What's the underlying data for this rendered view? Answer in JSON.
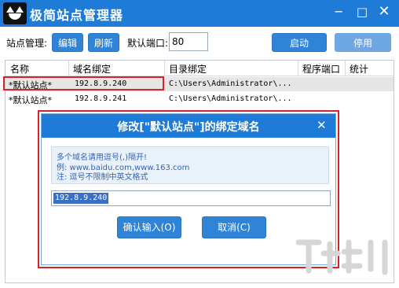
{
  "window": {
    "title": "极简站点管理器",
    "minimize_glyph": "─",
    "maximize_glyph": "□",
    "close_glyph": "✕"
  },
  "toolbar": {
    "site_mgmt_label": "站点管理:",
    "edit_label": "编辑",
    "refresh_label": "刷新",
    "port_label": "默认端口:",
    "port_value": "80",
    "start_label": "启动",
    "stop_label": "停用"
  },
  "table": {
    "columns": [
      "名称",
      "域名绑定",
      "目录绑定",
      "程序端口",
      "统计"
    ],
    "rows": [
      {
        "name": "*默认站点*",
        "domain": "192.8.9.240",
        "dir": "C:\\Users\\Administrator\\..."
      },
      {
        "name": "*默认站点*",
        "domain": "192.8.9.241",
        "dir": "C:\\Users\\Administrator\\..."
      }
    ]
  },
  "dialog": {
    "title": "修改[\"默认站点\"]的绑定域名",
    "close_glyph": "✕",
    "hint_line1": "多个域名请用逗号(,)隔开!",
    "hint_line2": "例: www.baidu.com,www.163.com",
    "hint_line3": "注: 逗号不限制中英文格式",
    "domain_value": "192.8.9.240",
    "confirm_label": "确认输入(O)",
    "cancel_label": "取消(C)"
  },
  "icons": {
    "app": "cat-logo-icon",
    "watermark": "download-watermark-icon"
  },
  "colors": {
    "titlebar": "#1e7bd7",
    "button": "#2f84d8",
    "highlight_red": "#d8232a"
  }
}
